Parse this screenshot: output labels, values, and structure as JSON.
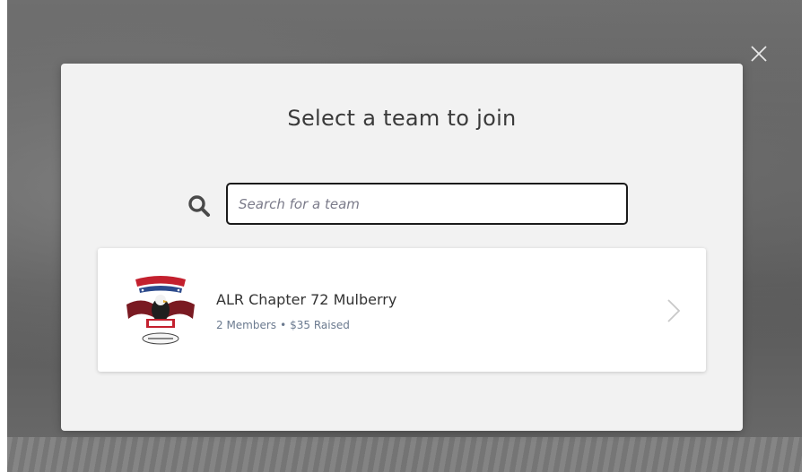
{
  "modal": {
    "title": "Select a team to join"
  },
  "search": {
    "placeholder": "Search for a team",
    "value": ""
  },
  "teams": [
    {
      "name": "ALR Chapter 72 Mulberry",
      "members": "2 Members",
      "raised": "$35 Raised"
    }
  ],
  "icons": {
    "close": "close-icon",
    "search": "search-icon",
    "chevron": "chevron-right-icon",
    "logo": "team-logo-emblem"
  },
  "colors": {
    "input_border": "#1b1b1b",
    "meta_text": "#6b7a8f",
    "banner_red": "#8a2e35"
  }
}
